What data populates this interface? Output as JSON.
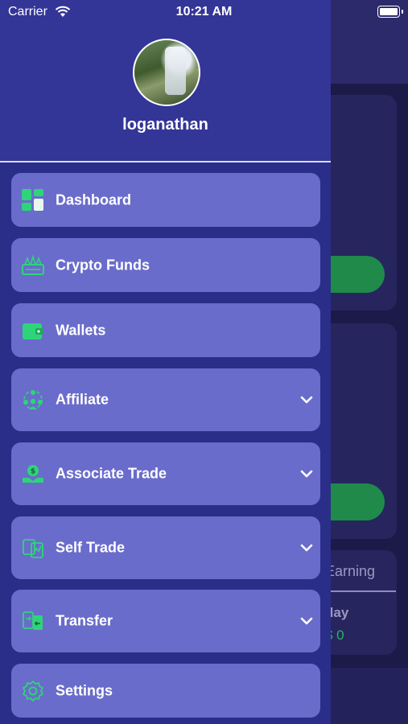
{
  "status_bar": {
    "carrier": "Carrier",
    "time": "10:21 AM"
  },
  "user": {
    "name": "loganathan"
  },
  "menu": [
    {
      "label": "Dashboard",
      "icon": "dashboard-icon",
      "expandable": false
    },
    {
      "label": "Crypto Funds",
      "icon": "crypto-funds-icon",
      "expandable": false
    },
    {
      "label": "Wallets",
      "icon": "wallet-icon",
      "expandable": false
    },
    {
      "label": "Affiliate",
      "icon": "affiliate-icon",
      "expandable": true
    },
    {
      "label": "Associate Trade",
      "icon": "associate-trade-icon",
      "expandable": true
    },
    {
      "label": "Self Trade",
      "icon": "self-trade-icon",
      "expandable": true
    },
    {
      "label": "Transfer",
      "icon": "transfer-icon",
      "expandable": true
    },
    {
      "label": "Settings",
      "icon": "settings-icon",
      "expandable": false
    }
  ],
  "background": {
    "tab_label": "Earning",
    "period_label": "day",
    "value": "$ 0"
  },
  "colors": {
    "drawer": "#2b2e88",
    "menu_item": "#6a6ccb",
    "icon_accent": "#2ed47a"
  }
}
